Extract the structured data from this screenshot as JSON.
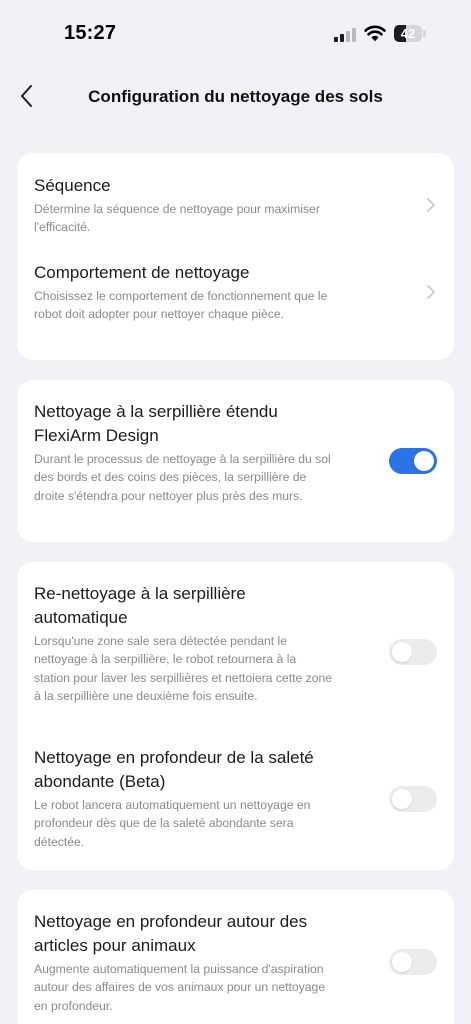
{
  "status_bar": {
    "time": "15:27",
    "battery_level": "42",
    "icons": [
      "signal-icon",
      "wifi-icon",
      "battery-icon"
    ]
  },
  "nav": {
    "title": "Configuration du nettoyage des sols",
    "back_icon": "chevron-left-icon"
  },
  "colors": {
    "background": "#f2f2f6",
    "card": "#ffffff",
    "accent": "#2b74e8",
    "toggle_off": "#ececef"
  },
  "sections": [
    {
      "items": [
        {
          "title": "Séquence",
          "description": "Détermine la séquence de nettoyage pour maximiser l'efficacité.",
          "control": "chevron-right-icon"
        },
        {
          "title": "Comportement de nettoyage",
          "description": "Choisissez le comportement de fonctionnement que le robot doit adopter pour nettoyer chaque pièce.",
          "control": "chevron-right-icon"
        }
      ]
    },
    {
      "items": [
        {
          "title": "Nettoyage à la serpillière étendu FlexiArm Design",
          "description": "Durant le processus de nettoyage à la serpillière du sol des bords et des coins des pièces, la serpillière de droite s'étendra pour nettoyer plus près des murs.",
          "enabled": true
        }
      ]
    },
    {
      "items": [
        {
          "title": "Re-nettoyage à la serpillière automatique",
          "description": "Lorsqu'une zone sale sera détectée pendant le nettoyage à la serpillière, le robot retournera à la station pour laver les serpillières et nettoiera cette zone à la serpillière une deuxième fois ensuite.",
          "enabled": false
        },
        {
          "title": "Nettoyage en profondeur de la saleté abondante (Beta)",
          "description": "Le robot lancera automatiquement un nettoyage en profondeur dès que de la saleté abondante sera détectée.",
          "enabled": false
        }
      ]
    },
    {
      "items": [
        {
          "title": "Nettoyage en profondeur autour des articles pour animaux",
          "description": "Augmente automatiquement la puissance d'aspiration autour des affaires de vos animaux pour un nettoyage en profondeur.",
          "enabled": false
        }
      ]
    }
  ]
}
